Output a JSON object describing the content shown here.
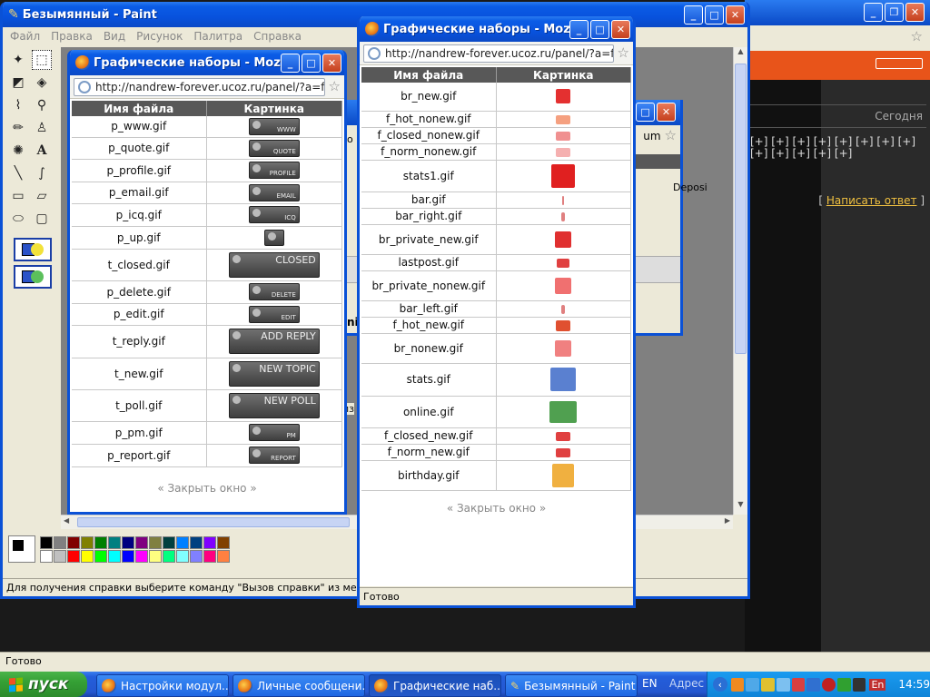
{
  "paint": {
    "title": "Безымянный - Paint",
    "menu": [
      "Файл",
      "Правка",
      "Вид",
      "Рисунок",
      "Палитра",
      "Справка"
    ],
    "status": "Для получения справки выберите команду \"Вызов справки\" из меню \"Справка\""
  },
  "bg_browser": {
    "today": "Сегодня",
    "plus_row1": "[+] [+] [+] [+] [+] [+] [+] [+]",
    "plus_row2": "[+] [+] [+] [+] [+]",
    "reply_link": "Написать ответ",
    "reply_open": "[",
    "reply_close": "]",
    "status": "Готово"
  },
  "mid_window": {
    "url_fragment": "um",
    "deposit": "Deposi",
    "side_fragment_1": "о",
    "side_fragment_2": "nic",
    "side_fragment_3": "из"
  },
  "win1": {
    "title": "Графические наборы - Mozill...",
    "url": "http://nandrew-forever.ucoz.ru/panel/?a=forum",
    "col_name": "Имя файла",
    "col_pic": "Картинка",
    "rows": [
      {
        "name": "p_www.gif",
        "label": "WWW",
        "big": false
      },
      {
        "name": "p_quote.gif",
        "label": "QUOTE",
        "big": false
      },
      {
        "name": "p_profile.gif",
        "label": "PROFILE",
        "big": false
      },
      {
        "name": "p_email.gif",
        "label": "EMAIL",
        "big": false
      },
      {
        "name": "p_icq.gif",
        "label": "ICQ",
        "big": false
      },
      {
        "name": "p_up.gif",
        "label": "",
        "big": false
      },
      {
        "name": "t_closed.gif",
        "label": "CLOSED",
        "big": true
      },
      {
        "name": "p_delete.gif",
        "label": "DELETE",
        "big": false
      },
      {
        "name": "p_edit.gif",
        "label": "EDIT",
        "big": false
      },
      {
        "name": "t_reply.gif",
        "label": "ADD REPLY",
        "big": true
      },
      {
        "name": "t_new.gif",
        "label": "NEW TOPIC",
        "big": true
      },
      {
        "name": "t_poll.gif",
        "label": "NEW POLL",
        "big": true
      },
      {
        "name": "p_pm.gif",
        "label": "PM",
        "big": false
      },
      {
        "name": "p_report.gif",
        "label": "REPORT",
        "big": false
      }
    ],
    "close": "« Закрыть окно »"
  },
  "win2": {
    "title": "Графические наборы - Mozill...",
    "url": "http://nandrew-forever.ucoz.ru/panel/?a=forum",
    "col_name": "Имя файла",
    "col_pic": "Картинка",
    "rows": [
      "br_new.gif",
      "f_hot_nonew.gif",
      "f_closed_nonew.gif",
      "f_norm_nonew.gif",
      "stats1.gif",
      "bar.gif",
      "bar_right.gif",
      "br_private_new.gif",
      "lastpost.gif",
      "br_private_nonew.gif",
      "bar_left.gif",
      "f_hot_new.gif",
      "br_nonew.gif",
      "stats.gif",
      "online.gif",
      "f_closed_new.gif",
      "f_norm_new.gif",
      "birthday.gif"
    ],
    "close": "« Закрыть окно »",
    "status": "Готово"
  },
  "taskbar": {
    "start": "пуск",
    "items": [
      "Настройки модул...",
      "Личные сообщени...",
      "Графические наб...",
      "Безымянный - Paint"
    ],
    "lang": "EN",
    "address": "Адрес",
    "lang_badge": "En",
    "clock": "14:59"
  },
  "colors": {
    "xp_blue": "#0a51d6",
    "start_green": "#3c9a3c",
    "header_gray": "#585858",
    "orange_bar": "#e8541a"
  }
}
